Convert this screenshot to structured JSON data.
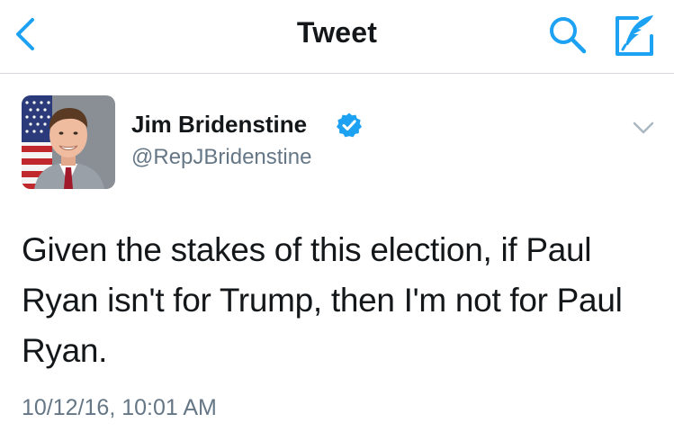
{
  "navbar": {
    "title": "Tweet",
    "icons": {
      "back": "chevron-left-icon",
      "search": "search-icon",
      "compose": "compose-icon"
    },
    "accent_color": "#1da1f2"
  },
  "tweet": {
    "author": {
      "display_name": "Jim Bridenstine",
      "handle": "@RepJBridenstine",
      "verified": true,
      "verified_color": "#1da1f2"
    },
    "text": "Given the stakes of this election, if Paul Ryan isn't for Trump, then I'm not for Paul Ryan.",
    "timestamp": "10/12/16, 10:01 AM"
  },
  "colors": {
    "text": "#14171a",
    "secondary": "#657786",
    "divider": "#d5d9dd"
  }
}
